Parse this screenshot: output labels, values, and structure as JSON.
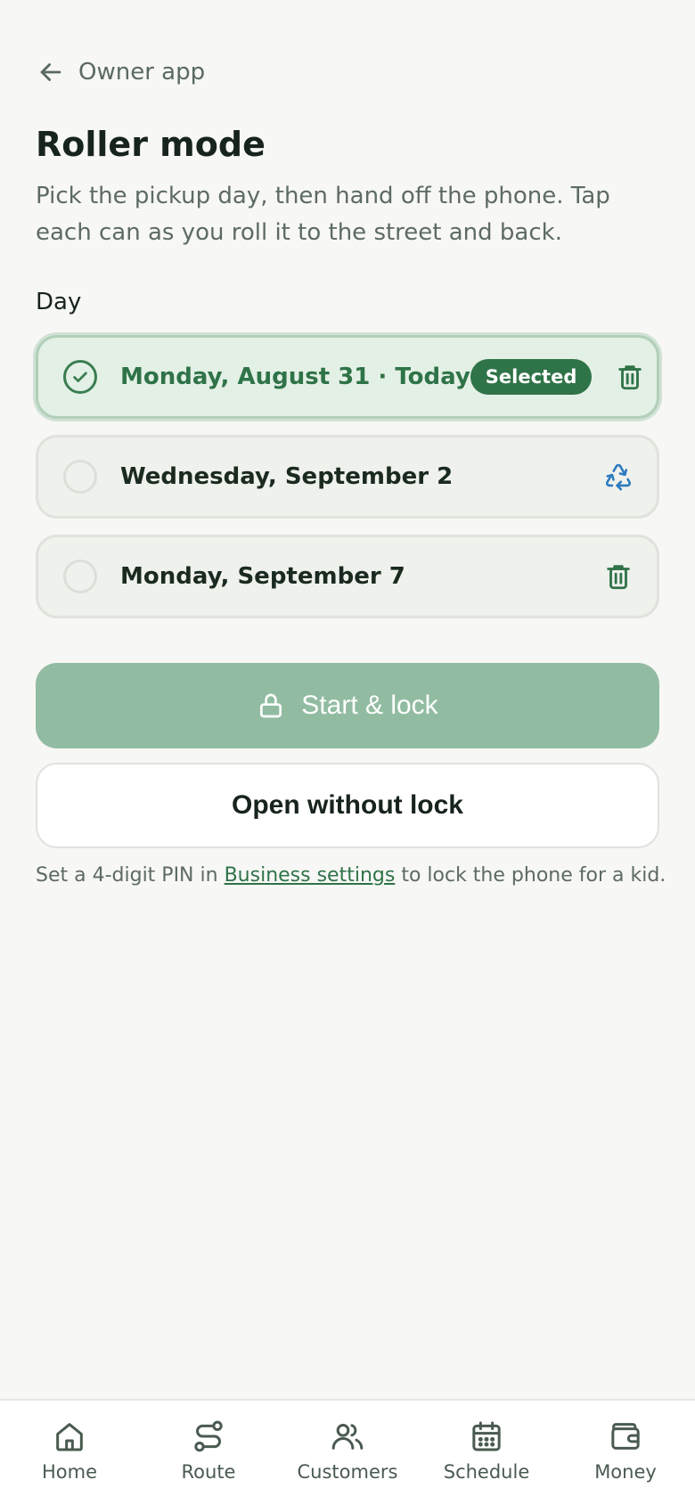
{
  "header": {
    "back_label": "Owner app",
    "title": "Roller mode",
    "description": "Pick the pickup day, then hand off the phone. Tap each can as you roll it to the street and back."
  },
  "day_section": {
    "label": "Day",
    "days": [
      {
        "name": "Monday, August 31 · Today",
        "selected": true,
        "badge": "Selected",
        "icon": "trash-icon"
      },
      {
        "name": "Wednesday, September 2",
        "selected": false,
        "badge": "",
        "icon": "recycle-icon"
      },
      {
        "name": "Monday, September 7",
        "selected": false,
        "badge": "",
        "icon": "trash-icon"
      }
    ]
  },
  "actions": {
    "start_lock_label": "Start & lock",
    "open_without_lock_label": "Open without lock"
  },
  "pin_note": {
    "before": "Set a 4-digit PIN in",
    "link": "Business settings",
    "after": "to lock the phone for a kid."
  },
  "bottom_nav": {
    "items": [
      {
        "label": "Home",
        "icon": "home-icon"
      },
      {
        "label": "Route",
        "icon": "route-icon"
      },
      {
        "label": "Customers",
        "icon": "customers-icon"
      },
      {
        "label": "Schedule",
        "icon": "schedule-icon"
      },
      {
        "label": "Money",
        "icon": "wallet-icon"
      }
    ]
  },
  "colors": {
    "accent": "#2f7348",
    "primary_button": "#92bca2",
    "recycle": "#2b7bbf",
    "background": "#f7f7f5"
  }
}
